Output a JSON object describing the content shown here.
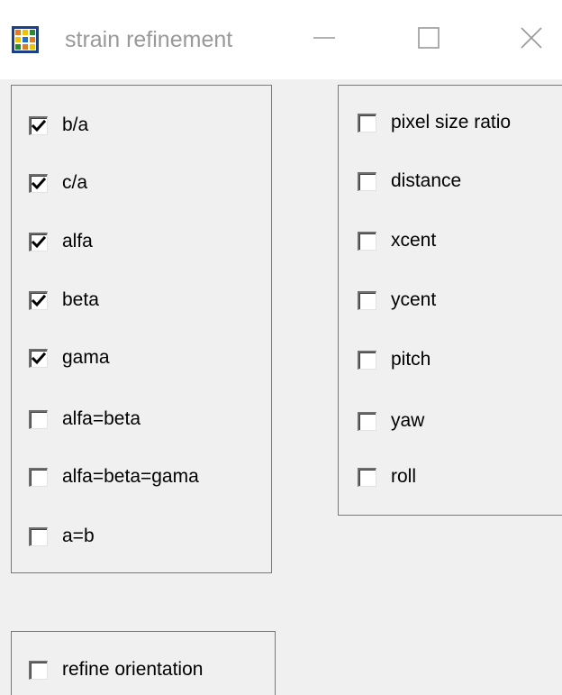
{
  "window": {
    "title": "strain refinement",
    "app_icon": "grid-app-icon",
    "controls": {
      "minimize_icon": "minimize-icon",
      "maximize_icon": "maximize-icon",
      "close_icon": "close-icon"
    }
  },
  "colors": {
    "background": "#f0f0f0",
    "titlebar": "#ffffff",
    "title_text": "#999999",
    "group_border": "#7a7a7a"
  },
  "lattice_group": {
    "items": [
      {
        "label": "b/a",
        "checked": true
      },
      {
        "label": "c/a",
        "checked": true
      },
      {
        "label": "alfa",
        "checked": true
      },
      {
        "label": "beta",
        "checked": true
      },
      {
        "label": "gama",
        "checked": true
      },
      {
        "label": "alfa=beta",
        "checked": false
      },
      {
        "label": "alfa=beta=gama",
        "checked": false
      },
      {
        "label": "a=b",
        "checked": false
      }
    ]
  },
  "detector_group": {
    "items": [
      {
        "label": "pixel size ratio",
        "checked": false
      },
      {
        "label": "distance",
        "checked": false
      },
      {
        "label": "xcent",
        "checked": false
      },
      {
        "label": "ycent",
        "checked": false
      },
      {
        "label": "pitch",
        "checked": false
      },
      {
        "label": "yaw",
        "checked": false
      },
      {
        "label": "roll",
        "checked": false
      }
    ]
  },
  "orientation_group": {
    "items": [
      {
        "label": "refine orientation",
        "checked": false
      }
    ]
  }
}
